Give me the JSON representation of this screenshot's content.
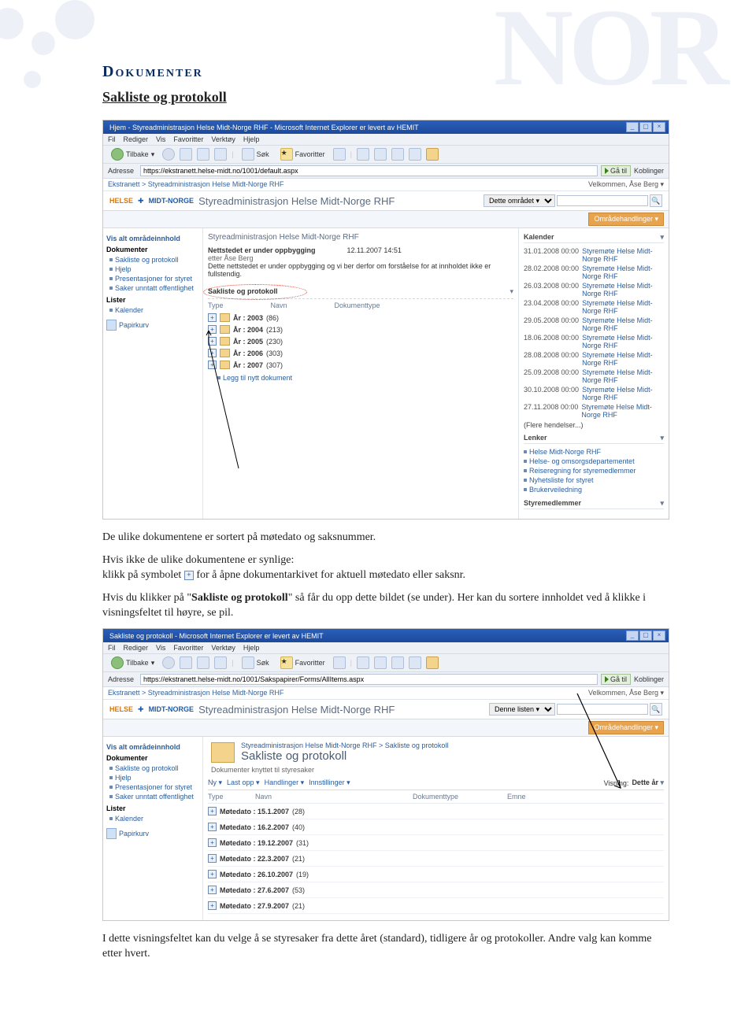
{
  "doc": {
    "h1": "Dokumenter",
    "h2": "Sakliste og protokoll",
    "p1": "De ulike dokumentene er sortert på møtedato og saksnummer.",
    "p2a": "Hvis ikke de ulike dokumentene er synlige:",
    "p2b": "klikk på symbolet",
    "p2c": "for å åpne dokumentarkivet for aktuell møtedato eller saksnr.",
    "p3a": "Hvis du klikker på \"",
    "p3b": "Sakliste og protokoll",
    "p3c": "\" så får du opp dette bildet (se under). Her kan du sortere innholdet ved å klikke i visningsfeltet til høyre, se pil.",
    "p4a": "I dette visningsfeltet kan du velge å se styresaker fra dette året (standard), tidligere år og protokoller.",
    "p4b": "Andre valg kan komme etter hvert."
  },
  "shot1": {
    "title": "Hjem - Styreadministrasjon Helse Midt-Norge RHF - Microsoft Internet Explorer er levert av HEMIT",
    "menus": [
      "Fil",
      "Rediger",
      "Vis",
      "Favoritter",
      "Verktøy",
      "Hjelp"
    ],
    "back": "Tilbake",
    "search": "Søk",
    "fav": "Favoritter",
    "addr_label": "Adresse",
    "url": "https://ekstranett.helse-midt.no/1001/default.aspx",
    "go": "Gå til",
    "links_lbl": "Koblinger",
    "breadcrumb": "Ekstranett > Styreadministrasjon Helse Midt-Norge RHF",
    "welcome": "Velkommen, Åse Berg ▾",
    "brand1": "HELSE",
    "brand2": "MIDT-NORGE",
    "banner_title": "Styreadministrasjon Helse Midt-Norge RHF",
    "scope": "Dette området ▾",
    "actionbar": "Områdehandlinger ▾",
    "leftnav": {
      "show_all": "Vis alt områdeinnhold",
      "dokumenter": "Dokumenter",
      "items": [
        "Sakliste og protokoll",
        "Hjelp",
        "Presentasjoner for styret",
        "Saker unntatt offentlighet"
      ],
      "lister": "Lister",
      "kalender": "Kalender",
      "papirkurv": "Papirkurv"
    },
    "notice": {
      "title": "Styreadministrasjon Helse Midt-Norge RHF",
      "line1": "Nettstedet er under oppbygging",
      "date": "12.11.2007 14:51",
      "who": "etter Åse Berg",
      "line2": "Dette nettstedet er under oppbygging og vi ber derfor om forståelse for at innholdet ikke er fullstendig."
    },
    "sak_header": "Sakliste og protokoll",
    "cols": [
      "Type",
      "Navn",
      "Dokumenttype"
    ],
    "years": [
      {
        "label": "År : 2003",
        "count": "(86)"
      },
      {
        "label": "År : 2004",
        "count": "(213)"
      },
      {
        "label": "År : 2005",
        "count": "(230)"
      },
      {
        "label": "År : 2006",
        "count": "(303)"
      },
      {
        "label": "År : 2007",
        "count": "(307)"
      }
    ],
    "add_new": "Legg til nytt dokument",
    "right": {
      "kalender": "Kalender",
      "calendar": [
        {
          "d": "31.01.2008 00:00",
          "t": "Styremøte Helse Midt-Norge RHF"
        },
        {
          "d": "28.02.2008 00:00",
          "t": "Styremøte Helse Midt-Norge RHF"
        },
        {
          "d": "26.03.2008 00:00",
          "t": "Styremøte Helse Midt-Norge RHF"
        },
        {
          "d": "23.04.2008 00:00",
          "t": "Styremøte Helse Midt-Norge RHF"
        },
        {
          "d": "29.05.2008 00:00",
          "t": "Styremøte Helse Midt-Norge RHF"
        },
        {
          "d": "18.06.2008 00:00",
          "t": "Styremøte Helse Midt-Norge RHF"
        },
        {
          "d": "28.08.2008 00:00",
          "t": "Styremøte Helse Midt-Norge RHF"
        },
        {
          "d": "25.09.2008 00:00",
          "t": "Styremøte Helse Midt-Norge RHF"
        },
        {
          "d": "30.10.2008 00:00",
          "t": "Styremøte Helse Midt-Norge RHF"
        },
        {
          "d": "27.11.2008 00:00",
          "t": "Styremøte Helse Midt-Norge RHF"
        }
      ],
      "more": "(Flere hendelser...)",
      "lenker": "Lenker",
      "links": [
        "Helse Midt-Norge RHF",
        "Helse- og omsorgsdepartementet",
        "Reiseregning for styremedlemmer",
        "Nyhetsliste for styret",
        "Brukerveiledning"
      ],
      "styremed": "Styremedlemmer"
    }
  },
  "shot2": {
    "title": "Sakliste og protokoll - Microsoft Internet Explorer er levert av HEMIT",
    "url": "https://ekstranett.helse-midt.no/1001/Sakspapirer/Forms/AllItems.aspx",
    "breadcrumb": "Ekstranett > Styreadministrasjon Helse Midt-Norge RHF",
    "scope": "Denne listen ▾",
    "bc2": "Styreadministrasjon Helse Midt-Norge RHF > Sakliste og protokoll",
    "ptitle": "Sakliste og protokoll",
    "sub": "Dokumenter knyttet til styresaker",
    "toolbar": {
      "ny": "Ny ▾",
      "last": "Last opp ▾",
      "handl": "Handlinger ▾",
      "inst": "Innstillinger ▾",
      "visning": "Visning:",
      "val": "Dette år"
    },
    "heads": [
      "Type",
      "Navn",
      "Dokumenttype",
      "Emne"
    ],
    "rows": [
      {
        "label": "Møtedato : 15.1.2007",
        "count": "(28)"
      },
      {
        "label": "Møtedato : 16.2.2007",
        "count": "(40)"
      },
      {
        "label": "Møtedato : 19.12.2007",
        "count": "(31)"
      },
      {
        "label": "Møtedato : 22.3.2007",
        "count": "(21)"
      },
      {
        "label": "Møtedato : 26.10.2007",
        "count": "(19)"
      },
      {
        "label": "Møtedato : 27.6.2007",
        "count": "(53)"
      },
      {
        "label": "Møtedato : 27.9.2007",
        "count": "(21)"
      }
    ]
  }
}
